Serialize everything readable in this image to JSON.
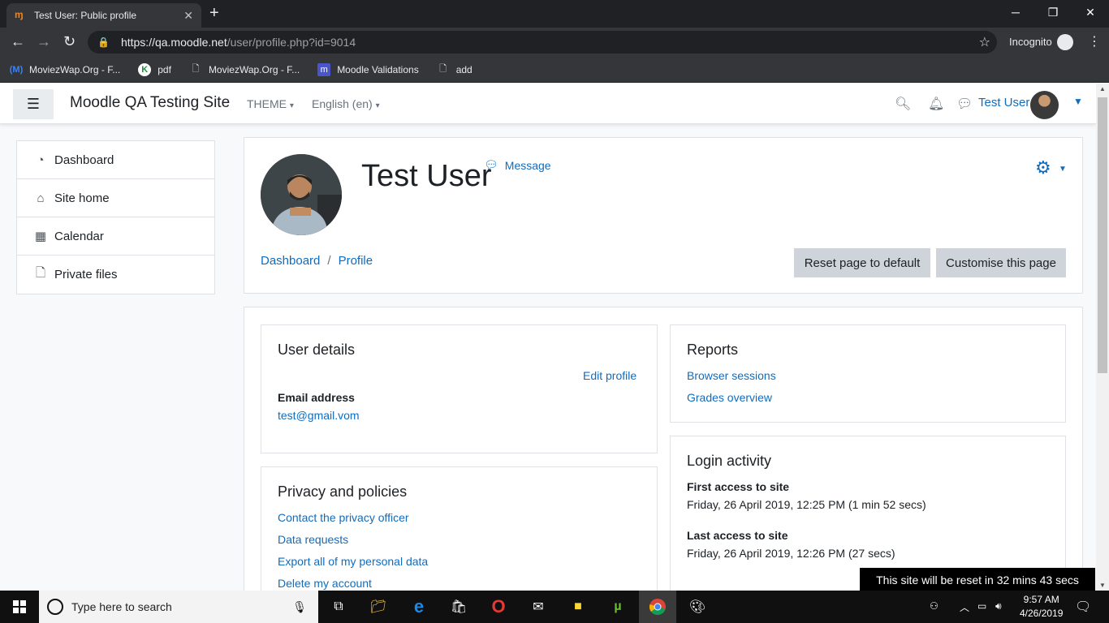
{
  "browser": {
    "tab_title": "Test User: Public profile",
    "url_host": "https://qa.moodle.net",
    "url_path": "/user/profile.php?id=9014",
    "incognito_label": "Incognito",
    "bookmarks": [
      {
        "label": "MoviezWap.Org - F...",
        "icon": "moviezwap-icon"
      },
      {
        "label": "pdf",
        "icon": "pdf-icon"
      },
      {
        "label": "MoviezWap.Org - F...",
        "icon": "page-icon"
      },
      {
        "label": "Moodle Validations",
        "icon": "moodle-icon"
      },
      {
        "label": "add",
        "icon": "page-icon"
      }
    ]
  },
  "navbar": {
    "site_name": "Moodle QA Testing Site",
    "theme_menu": "THEME",
    "language_menu": "English (en)",
    "user_name": "Test User"
  },
  "drawer": {
    "items": [
      {
        "label": "Dashboard",
        "icon": "dashboard-icon"
      },
      {
        "label": "Site home",
        "icon": "home-icon"
      },
      {
        "label": "Calendar",
        "icon": "calendar-icon"
      },
      {
        "label": "Private files",
        "icon": "file-icon"
      }
    ]
  },
  "header": {
    "user_heading": "Test User",
    "message_link": "Message",
    "breadcrumb": [
      "Dashboard",
      "Profile"
    ],
    "reset_button": "Reset page to default",
    "customise_button": "Customise this page"
  },
  "user_details": {
    "title": "User details",
    "edit_profile": "Edit profile",
    "email_label": "Email address",
    "email_value": "test@gmail.vom"
  },
  "privacy": {
    "title": "Privacy and policies",
    "links": [
      "Contact the privacy officer",
      "Data requests",
      "Export all of my personal data",
      "Delete my account"
    ]
  },
  "reports": {
    "title": "Reports",
    "links": [
      "Browser sessions",
      "Grades overview"
    ]
  },
  "login_activity": {
    "title": "Login activity",
    "first_label": "First access to site",
    "first_value": "Friday, 26 April 2019, 12:25 PM  (1 min 52 secs)",
    "last_label": "Last access to site",
    "last_value": "Friday, 26 April 2019, 12:26 PM  (27 secs)"
  },
  "reset_notice": "This site will be reset in 32 mins 43 secs",
  "taskbar": {
    "search_placeholder": "Type here to search",
    "time": "9:57 AM",
    "date": "4/26/2019"
  }
}
